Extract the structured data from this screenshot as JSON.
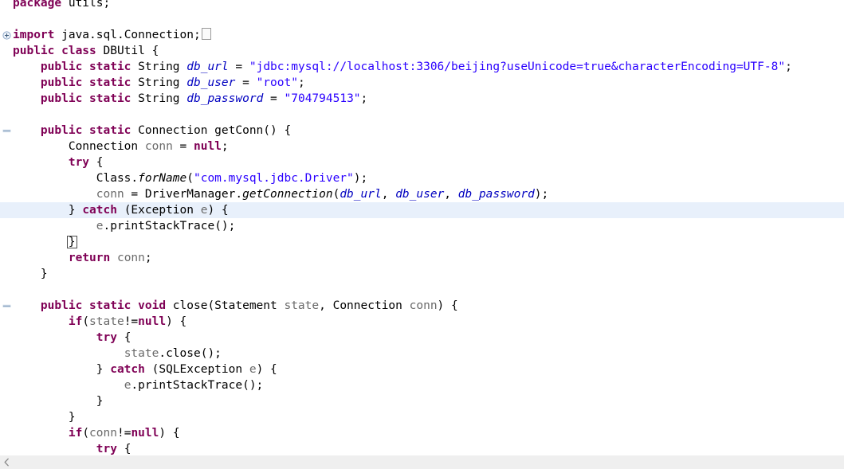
{
  "editor": {
    "language": "java",
    "colors": {
      "keyword": "#7f0055",
      "string": "#2a00ff",
      "field": "#0000c0",
      "parameter": "#6a6a6a",
      "plain": "#000000",
      "highlight_line_bg": "#e8f0fb",
      "background": "#ffffff",
      "scrollbar_bg": "#efefef"
    },
    "highlighted_line_index": 13,
    "lines": [
      {
        "index": 0,
        "fold": null,
        "tokens": [
          {
            "t": "package",
            "c": "kw"
          },
          {
            "t": " utils;",
            "c": "plain"
          }
        ]
      },
      {
        "index": 1,
        "fold": null,
        "tokens": []
      },
      {
        "index": 2,
        "fold": "plus",
        "tokens": [
          {
            "t": "import",
            "c": "kw"
          },
          {
            "t": " java.sql.Connection;",
            "c": "plain"
          },
          {
            "t": "",
            "c": "collapsed-box"
          }
        ]
      },
      {
        "index": 3,
        "fold": null,
        "tokens": [
          {
            "t": "public class",
            "c": "kw"
          },
          {
            "t": " DBUtil {",
            "c": "plain"
          }
        ]
      },
      {
        "index": 4,
        "fold": null,
        "tokens": [
          {
            "t": "    ",
            "c": "plain"
          },
          {
            "t": "public static",
            "c": "kw"
          },
          {
            "t": " String ",
            "c": "plain"
          },
          {
            "t": "db_url",
            "c": "fieldi"
          },
          {
            "t": " = ",
            "c": "plain"
          },
          {
            "t": "\"jdbc:mysql://localhost:3306/beijing?useUnicode=true&characterEncoding=UTF-8\"",
            "c": "str"
          },
          {
            "t": ";",
            "c": "plain"
          }
        ]
      },
      {
        "index": 5,
        "fold": null,
        "tokens": [
          {
            "t": "    ",
            "c": "plain"
          },
          {
            "t": "public static",
            "c": "kw"
          },
          {
            "t": " String ",
            "c": "plain"
          },
          {
            "t": "db_user",
            "c": "fieldi"
          },
          {
            "t": " = ",
            "c": "plain"
          },
          {
            "t": "\"root\"",
            "c": "str"
          },
          {
            "t": ";",
            "c": "plain"
          }
        ]
      },
      {
        "index": 6,
        "fold": null,
        "tokens": [
          {
            "t": "    ",
            "c": "plain"
          },
          {
            "t": "public static",
            "c": "kw"
          },
          {
            "t": " String ",
            "c": "plain"
          },
          {
            "t": "db_password",
            "c": "fieldi"
          },
          {
            "t": " = ",
            "c": "plain"
          },
          {
            "t": "\"704794513\"",
            "c": "str"
          },
          {
            "t": ";",
            "c": "plain"
          }
        ]
      },
      {
        "index": 7,
        "fold": null,
        "tokens": []
      },
      {
        "index": 8,
        "fold": "minus",
        "tokens": [
          {
            "t": "    ",
            "c": "plain"
          },
          {
            "t": "public static",
            "c": "kw"
          },
          {
            "t": " Connection getConn() {",
            "c": "plain"
          }
        ]
      },
      {
        "index": 9,
        "fold": null,
        "tokens": [
          {
            "t": "        Connection ",
            "c": "plain"
          },
          {
            "t": "conn",
            "c": "param"
          },
          {
            "t": " = ",
            "c": "plain"
          },
          {
            "t": "null",
            "c": "kw"
          },
          {
            "t": ";",
            "c": "plain"
          }
        ]
      },
      {
        "index": 10,
        "fold": null,
        "tokens": [
          {
            "t": "        ",
            "c": "plain"
          },
          {
            "t": "try",
            "c": "kw"
          },
          {
            "t": " {",
            "c": "plain"
          }
        ]
      },
      {
        "index": 11,
        "fold": null,
        "tokens": [
          {
            "t": "            Class.",
            "c": "plain"
          },
          {
            "t": "forName",
            "c": "methi"
          },
          {
            "t": "(",
            "c": "plain"
          },
          {
            "t": "\"com.mysql.jdbc.Driver\"",
            "c": "str"
          },
          {
            "t": ");",
            "c": "plain"
          }
        ]
      },
      {
        "index": 12,
        "fold": null,
        "tokens": [
          {
            "t": "            ",
            "c": "plain"
          },
          {
            "t": "conn",
            "c": "param"
          },
          {
            "t": " = DriverManager.",
            "c": "plain"
          },
          {
            "t": "getConnection",
            "c": "methi"
          },
          {
            "t": "(",
            "c": "plain"
          },
          {
            "t": "db_url",
            "c": "fieldi"
          },
          {
            "t": ", ",
            "c": "plain"
          },
          {
            "t": "db_user",
            "c": "fieldi"
          },
          {
            "t": ", ",
            "c": "plain"
          },
          {
            "t": "db_password",
            "c": "fieldi"
          },
          {
            "t": ");",
            "c": "plain"
          }
        ]
      },
      {
        "index": 13,
        "fold": null,
        "tokens": [
          {
            "t": "        } ",
            "c": "plain"
          },
          {
            "t": "catch",
            "c": "kw"
          },
          {
            "t": " (Exception ",
            "c": "plain"
          },
          {
            "t": "e",
            "c": "param"
          },
          {
            "t": ") {",
            "c": "plain"
          }
        ]
      },
      {
        "index": 14,
        "fold": null,
        "tokens": [
          {
            "t": "            ",
            "c": "plain"
          },
          {
            "t": "e",
            "c": "param"
          },
          {
            "t": ".",
            "c": "plain"
          },
          {
            "t": "printStackTrace",
            "c": "plain"
          },
          {
            "t": "();",
            "c": "plain"
          }
        ]
      },
      {
        "index": 15,
        "fold": null,
        "tokens": [
          {
            "t": "        ",
            "c": "plain"
          },
          {
            "t": "}",
            "c": "bracket-match"
          }
        ]
      },
      {
        "index": 16,
        "fold": null,
        "tokens": [
          {
            "t": "        ",
            "c": "plain"
          },
          {
            "t": "return",
            "c": "kw"
          },
          {
            "t": " ",
            "c": "plain"
          },
          {
            "t": "conn",
            "c": "param"
          },
          {
            "t": ";",
            "c": "plain"
          }
        ]
      },
      {
        "index": 17,
        "fold": null,
        "tokens": [
          {
            "t": "    }",
            "c": "plain"
          }
        ]
      },
      {
        "index": 18,
        "fold": null,
        "tokens": []
      },
      {
        "index": 19,
        "fold": "minus",
        "tokens": [
          {
            "t": "    ",
            "c": "plain"
          },
          {
            "t": "public static void",
            "c": "kw"
          },
          {
            "t": " close(Statement ",
            "c": "plain"
          },
          {
            "t": "state",
            "c": "param"
          },
          {
            "t": ", Connection ",
            "c": "plain"
          },
          {
            "t": "conn",
            "c": "param"
          },
          {
            "t": ") {",
            "c": "plain"
          }
        ]
      },
      {
        "index": 20,
        "fold": null,
        "tokens": [
          {
            "t": "        ",
            "c": "plain"
          },
          {
            "t": "if",
            "c": "kw"
          },
          {
            "t": "(",
            "c": "plain"
          },
          {
            "t": "state",
            "c": "param"
          },
          {
            "t": "!=",
            "c": "plain"
          },
          {
            "t": "null",
            "c": "kw"
          },
          {
            "t": ") {",
            "c": "plain"
          }
        ]
      },
      {
        "index": 21,
        "fold": null,
        "tokens": [
          {
            "t": "            ",
            "c": "plain"
          },
          {
            "t": "try",
            "c": "kw"
          },
          {
            "t": " {",
            "c": "plain"
          }
        ]
      },
      {
        "index": 22,
        "fold": null,
        "tokens": [
          {
            "t": "                ",
            "c": "plain"
          },
          {
            "t": "state",
            "c": "param"
          },
          {
            "t": ".close();",
            "c": "plain"
          }
        ]
      },
      {
        "index": 23,
        "fold": null,
        "tokens": [
          {
            "t": "            } ",
            "c": "plain"
          },
          {
            "t": "catch",
            "c": "kw"
          },
          {
            "t": " (SQLException ",
            "c": "plain"
          },
          {
            "t": "e",
            "c": "param"
          },
          {
            "t": ") {",
            "c": "plain"
          }
        ]
      },
      {
        "index": 24,
        "fold": null,
        "tokens": [
          {
            "t": "                ",
            "c": "plain"
          },
          {
            "t": "e",
            "c": "param"
          },
          {
            "t": ".printStackTrace();",
            "c": "plain"
          }
        ]
      },
      {
        "index": 25,
        "fold": null,
        "tokens": [
          {
            "t": "            }",
            "c": "plain"
          }
        ]
      },
      {
        "index": 26,
        "fold": null,
        "tokens": [
          {
            "t": "        }",
            "c": "plain"
          }
        ]
      },
      {
        "index": 27,
        "fold": null,
        "tokens": [
          {
            "t": "        ",
            "c": "plain"
          },
          {
            "t": "if",
            "c": "kw"
          },
          {
            "t": "(",
            "c": "plain"
          },
          {
            "t": "conn",
            "c": "param"
          },
          {
            "t": "!=",
            "c": "plain"
          },
          {
            "t": "null",
            "c": "kw"
          },
          {
            "t": ") {",
            "c": "plain"
          }
        ]
      },
      {
        "index": 28,
        "fold": null,
        "tokens": [
          {
            "t": "            ",
            "c": "plain"
          },
          {
            "t": "try",
            "c": "kw"
          },
          {
            "t": " {",
            "c": "plain"
          }
        ]
      }
    ]
  },
  "scrollbar": {
    "left_arrow_glyph": "‹",
    "orientation": "horizontal"
  }
}
